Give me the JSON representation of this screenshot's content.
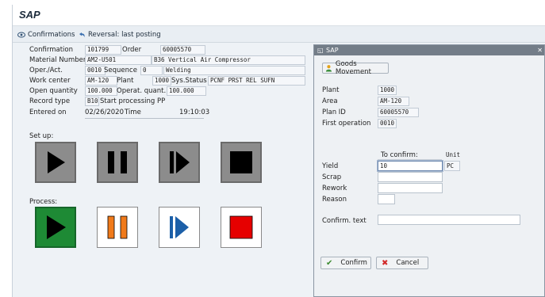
{
  "app": {
    "title": "SAP"
  },
  "toolbar": {
    "confirmations_label": "Confirmations",
    "reversal_label": "Reversal: last posting"
  },
  "form": {
    "confirmation_label": "Confirmation",
    "confirmation_value": "101799",
    "order_label": "Order",
    "order_value": "60005570",
    "material_label": "Material Number",
    "material_value": "AM2-U501",
    "material_desc": "B36 Vertical Air Compressor",
    "operact_label": "Oper./Act.",
    "operact_value": "0010",
    "sequence_label": "Sequence",
    "sequence_value": "0",
    "operation_desc": "Welding",
    "workcenter_label": "Work center",
    "workcenter_value": "AM-120",
    "plant_label": "Plant",
    "plant_value": "1000",
    "sysstatus_label": "Sys.Status",
    "sysstatus_value": "PCNF PRST REL  SUFN",
    "openqty_label": "Open quantity",
    "openqty_value": "100.000",
    "operqty_label": "Operat. quant.",
    "operqty_value": "100.000",
    "recordtype_label": "Record type",
    "recordtype_value": "B10",
    "recordtype_desc": "Start processing PP",
    "enteredon_label": "Entered on",
    "enteredon_value": "02/26/2020",
    "time_label": "Time",
    "time_value": "19:10:03"
  },
  "sections": {
    "setup_label": "Set up:",
    "process_label": "Process:"
  },
  "dialog": {
    "title": "SAP",
    "goods_movement_label": "Goods Movement",
    "plant_label": "Plant",
    "plant_value": "1000",
    "area_label": "Area",
    "area_value": "AM-120",
    "planid_label": "Plan ID",
    "planid_value": "60005570",
    "firstop_label": "First operation",
    "firstop_value": "0010",
    "to_confirm_header": "To confirm:",
    "unit_header": "Unit",
    "yield_label": "Yield",
    "yield_value": "10",
    "unit_value": "PC",
    "scrap_label": "Scrap",
    "rework_label": "Rework",
    "reason_label": "Reason",
    "confirm_text_label": "Confirm. text",
    "confirm_button": "Confirm",
    "cancel_button": "Cancel"
  },
  "colors": {
    "process_start": "#1e8a35",
    "process_pause": "#f07a1a",
    "process_continue": "#1c5fa8",
    "process_stop": "#e60000"
  }
}
